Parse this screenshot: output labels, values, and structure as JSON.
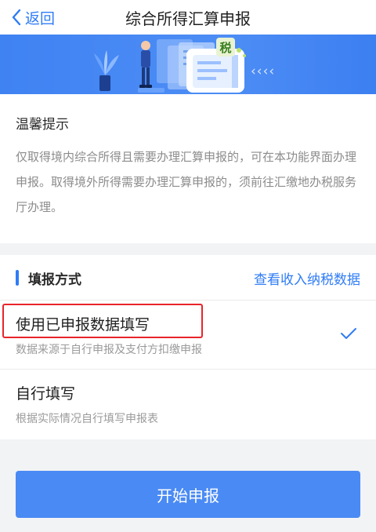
{
  "navbar": {
    "back_label": "返回",
    "title": "综合所得汇算申报"
  },
  "banner": {
    "tax_badge": "税",
    "arrows": "‹‹‹‹"
  },
  "tips": {
    "title": "温馨提示",
    "body": "仅取得境内综合所得且需要办理汇算申报的，可在本功能界面办理申报。取得境外所得需要办理汇算申报的，须前往汇缴地办税服务厅办理。"
  },
  "method": {
    "title": "填报方式",
    "view_link": "查看收入纳税数据",
    "options": [
      {
        "title": "使用已申报数据填写",
        "subtitle": "数据来源于自行申报及支付方扣缴申报",
        "selected": true
      },
      {
        "title": "自行填写",
        "subtitle": "根据实际情况自行填写申报表",
        "selected": false
      }
    ]
  },
  "start_button": {
    "label": "开始申报"
  },
  "colors": {
    "accent": "#2f7cf6",
    "button": "#4a8af4",
    "highlight": "#e8242a"
  }
}
